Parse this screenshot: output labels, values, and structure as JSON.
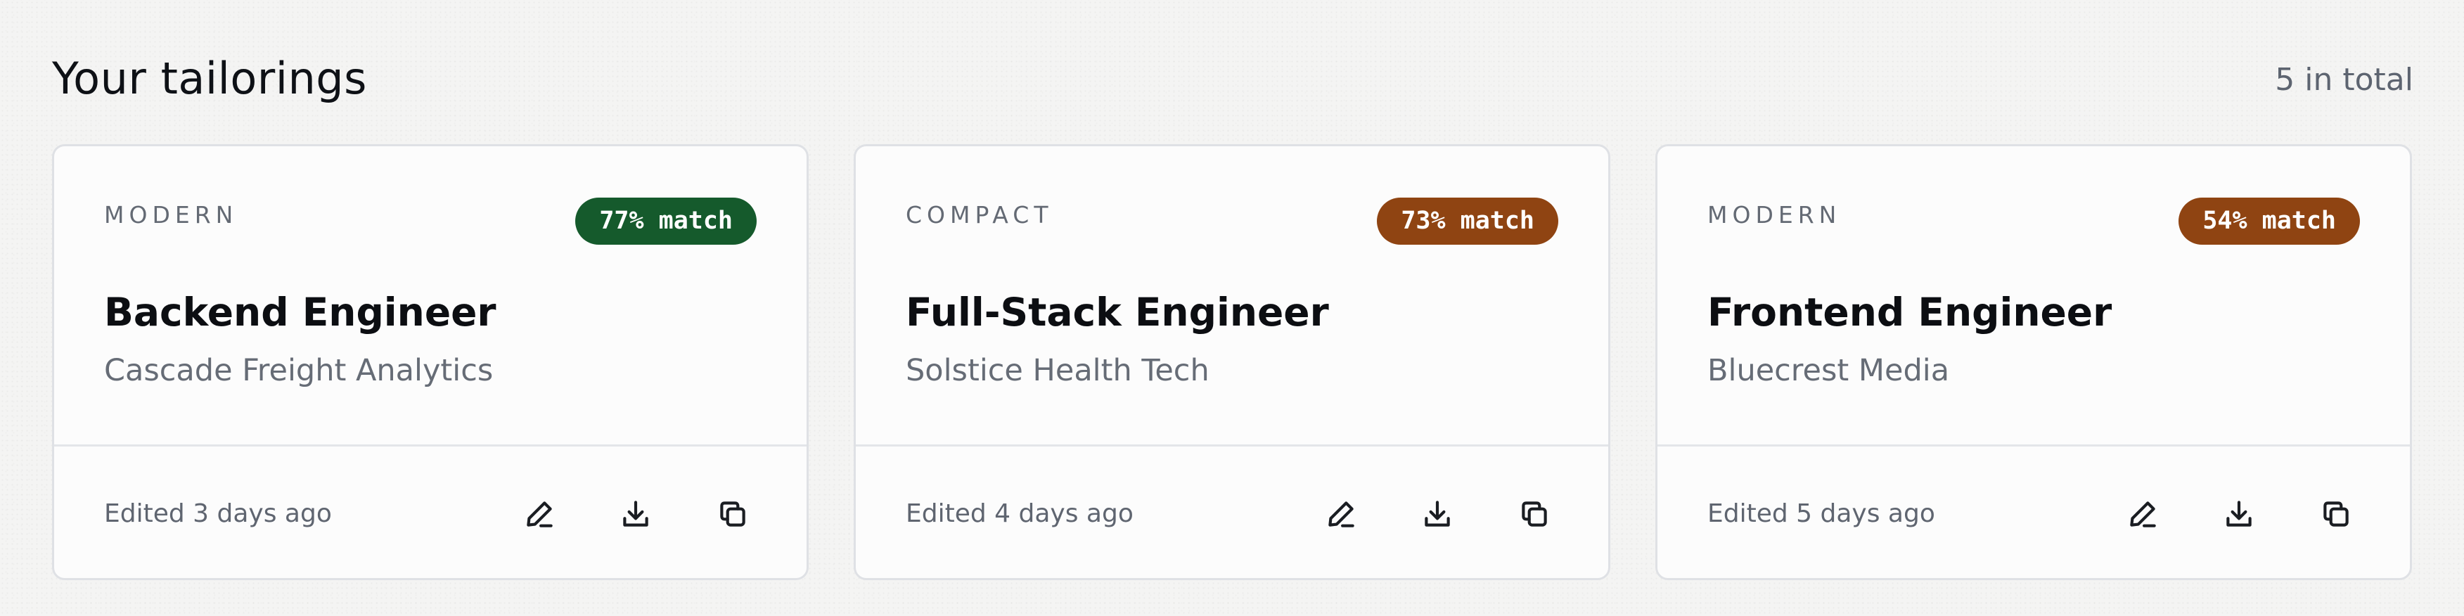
{
  "section": {
    "title": "Your tailorings",
    "total": "5 in total"
  },
  "cards": [
    {
      "style": "MODERN",
      "match": "77% match",
      "match_color": "#155a2c",
      "title": "Backend Engineer",
      "company": "Cascade Freight Analytics",
      "edited": "Edited 3 days ago"
    },
    {
      "style": "COMPACT",
      "match": "73% match",
      "match_color": "#8f4412",
      "title": "Full-Stack Engineer",
      "company": "Solstice Health Tech",
      "edited": "Edited 4 days ago"
    },
    {
      "style": "MODERN",
      "match": "54% match",
      "match_color": "#8f4412",
      "title": "Frontend Engineer",
      "company": "Bluecrest Media",
      "edited": "Edited 5 days ago"
    }
  ],
  "icons": {
    "edit": "pen-icon",
    "download": "download-icon",
    "duplicate": "copy-icon"
  }
}
